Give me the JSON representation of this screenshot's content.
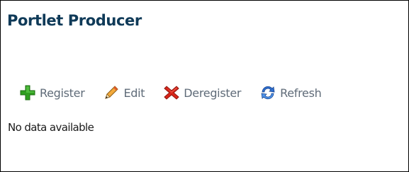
{
  "portlet": {
    "title": "Portlet Producer"
  },
  "toolbar": {
    "buttons": [
      {
        "label": "Register",
        "icon": "plus-icon"
      },
      {
        "label": "Edit",
        "icon": "pencil-icon"
      },
      {
        "label": "Deregister",
        "icon": "delete-x-icon"
      },
      {
        "label": "Refresh",
        "icon": "refresh-icon"
      }
    ]
  },
  "table": {
    "empty_message": "No data available"
  },
  "colors": {
    "title": "#0f3a58",
    "toolbar_text": "#5f6b78",
    "plus_green": "#2f9e1f",
    "delete_red": "#d8261a",
    "refresh_blue": "#2f6fcf",
    "pencil_orange": "#e07b1a"
  }
}
